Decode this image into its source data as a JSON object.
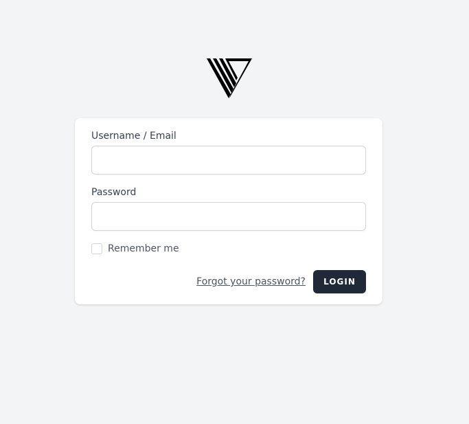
{
  "brand": {
    "logo_icon": "v-stripes-logo-icon",
    "logo_color": "#000000"
  },
  "form": {
    "username_label": "Username / Email",
    "username_value": "",
    "password_label": "Password",
    "password_value": "",
    "remember_label": "Remember me",
    "remember_checked": false,
    "forgot_link": "Forgot your password?",
    "login_button": "LOGIN"
  },
  "colors": {
    "page_background": "#f3f4f6",
    "card_background": "#ffffff",
    "button_background": "#1f2937",
    "button_text": "#ffffff"
  }
}
